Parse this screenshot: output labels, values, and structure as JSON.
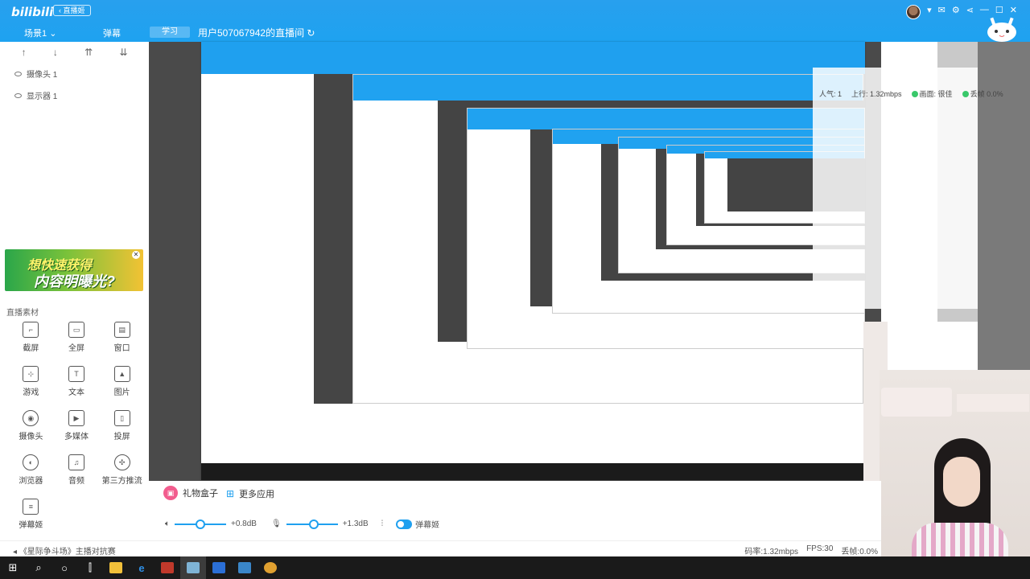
{
  "app": {
    "logo": "bilibili",
    "back_pill": "‹ 直播姬",
    "scene_selector": "场景1",
    "danmu_tab": "弹幕",
    "category": "学习",
    "room_title": "用户507067942的直播间",
    "window_icons": [
      "avatar",
      "chevron-down-icon",
      "mail-icon",
      "gear-icon",
      "share-icon",
      "minimize-icon",
      "maximize-icon",
      "close-icon"
    ]
  },
  "sources": {
    "toolbar": [
      "↑",
      "↓",
      "⇈",
      "⇊"
    ],
    "items": [
      {
        "label": "摄像头 1"
      },
      {
        "label": "显示器 1"
      }
    ]
  },
  "banner": {
    "line1": "想快速获得",
    "line2": "内容明曝光?"
  },
  "materials": {
    "title": "直播素材",
    "items": [
      {
        "label": "截屏",
        "icon": "crop-icon"
      },
      {
        "label": "全屏",
        "icon": "monitor-icon"
      },
      {
        "label": "窗口",
        "icon": "window-icon"
      },
      {
        "label": "游戏",
        "icon": "gamepad-icon"
      },
      {
        "label": "文本",
        "icon": "text-icon"
      },
      {
        "label": "图片",
        "icon": "image-icon"
      },
      {
        "label": "摄像头",
        "icon": "camera-icon"
      },
      {
        "label": "多媒体",
        "icon": "media-icon"
      },
      {
        "label": "投屏",
        "icon": "phone-icon"
      },
      {
        "label": "浏览器",
        "icon": "globe-icon"
      },
      {
        "label": "音频",
        "icon": "music-icon"
      },
      {
        "label": "第三方推流",
        "icon": "stream-icon"
      },
      {
        "label": "弹幕姬",
        "icon": "chat-icon"
      }
    ]
  },
  "bottom": {
    "gift_box": "礼物盒子",
    "more_apps": "更多应用",
    "speaker_db": "+0.8dB",
    "mic_db": "+1.3dB",
    "danmu_toggle": "弹幕姬"
  },
  "stats": {
    "popularity": "人气: 1",
    "upload": "上行: 1.32mbps",
    "quality": "画面: 很佳",
    "drop": "丢帧 0.0%"
  },
  "statusbar": {
    "left": "《星际争斗场》主播对抗赛",
    "bitrate": "码率:1.32mbps",
    "fps": "FPS:30",
    "drop": "丢帧:0.0%"
  },
  "taskbar": [
    "windows-icon",
    "search-icon",
    "task-view-icon",
    "multitask-icon",
    "explorer-icon",
    "edge-icon",
    "app-red-icon",
    "app-active-icon",
    "word-icon",
    "photos-icon",
    "media-icon"
  ]
}
